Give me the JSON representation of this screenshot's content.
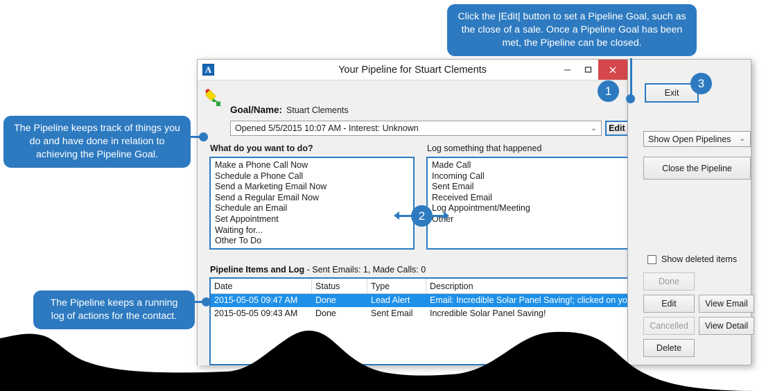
{
  "window": {
    "title": "Your Pipeline for Stuart Clements",
    "app_icon": "app-a-icon",
    "minimize": "–",
    "maximize": "□",
    "close": "×"
  },
  "goal": {
    "label": "Goal/Name:",
    "value": "Stuart Clements"
  },
  "pipeline_select": {
    "value": "Opened 5/5/2015 10:07 AM - Interest: Unknown",
    "caret": "⌄"
  },
  "edit_button": "Edit",
  "exit_button": "Exit",
  "columns": {
    "left_header": "What do you want to do?",
    "right_header": "Log something that happened"
  },
  "todo_list": [
    "Make a Phone Call Now",
    "Schedule a Phone Call",
    "Send a Marketing Email Now",
    "Send a Regular Email Now",
    "Schedule an Email",
    "Set Appointment",
    "Waiting for...",
    "Other To Do"
  ],
  "log_list": [
    "Made Call",
    "Incoming Call",
    "Sent Email",
    "Received Email",
    "Log Appointment/Meeting",
    "Other"
  ],
  "log_section": {
    "title_bold": "Pipeline Items and Log",
    "title_rest": " - Sent Emails: 1, Made Calls: 0",
    "headers": [
      "Date",
      "Status",
      "Type",
      "Description"
    ],
    "rows": [
      {
        "date": "2015-05-05  09:47 AM",
        "status": "Done",
        "type": "Lead Alert",
        "description": "Email: Incredible Solar Panel Saving!; clicked on your link",
        "selected": true
      },
      {
        "date": "2015-05-05  09:43 AM",
        "status": "Done",
        "type": "Sent Email",
        "description": "Incredible Solar Panel Saving!",
        "selected": false
      }
    ]
  },
  "side_panel": {
    "show_select": "Show Open Pipelines",
    "show_select_caret": "⌄",
    "close_pipeline": "Close the Pipeline",
    "show_deleted_label": "Show deleted items",
    "show_deleted_checked": false,
    "buttons": {
      "done": "Done",
      "edit": "Edit",
      "view_email": "View Email",
      "cancelled": "Cancelled",
      "view_detail": "View Detail",
      "delete": "Delete"
    }
  },
  "callouts": {
    "top": "Click the |Edit| button to set a Pipeline Goal, such as the close of a sale.  Once a Pipeline Goal has been met, the Pipeline can be closed.",
    "left": "The Pipeline keeps track of things you do and have done in relation to achieving the Pipeline Goal.",
    "log": "The Pipeline keeps a running log of actions for the contact."
  },
  "markers": {
    "one": "1",
    "two": "2",
    "three": "3"
  },
  "colors": {
    "accent_blue": "#2d7ac0",
    "selection_blue": "#1e90e8",
    "close_red": "#d6474c",
    "window_bg": "#f0f0f0"
  }
}
